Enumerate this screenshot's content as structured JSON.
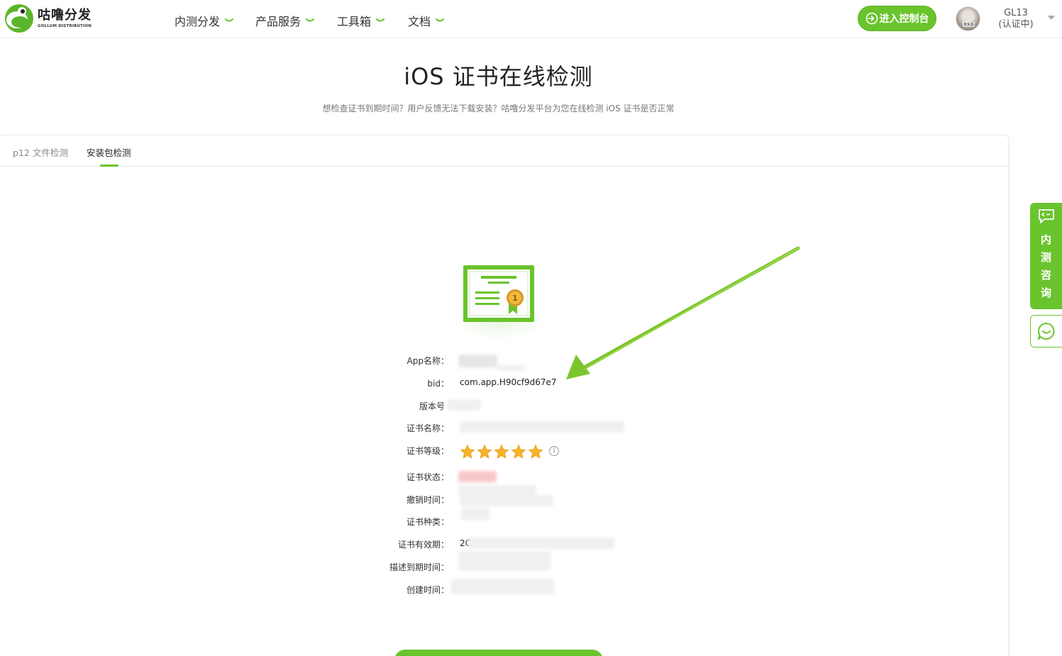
{
  "brand": {
    "name_cn": "咕噜分发",
    "name_en": "GOLLUM DISTRIBUTION",
    "accent": "#6ac42d"
  },
  "nav": {
    "items": [
      {
        "label": "内测分发"
      },
      {
        "label": "产品服务"
      },
      {
        "label": "工具箱"
      },
      {
        "label": "文档"
      }
    ],
    "console_label": "进入控制台",
    "avatar_tag": "未实名",
    "user_name": "GL13",
    "user_status": "(认证中)"
  },
  "page": {
    "title": "iOS 证书在线检测",
    "subtitle": "想检查证书到期时间？用户反馈无法下载安装？咕噜分发平台为您在线检测 iOS 证书是否正常"
  },
  "tabs": [
    {
      "label": "p12 文件检测",
      "active": false
    },
    {
      "label": "安装包检测",
      "active": true
    }
  ],
  "result": {
    "rows": [
      {
        "label": "App名称：",
        "value": ""
      },
      {
        "label": "bid：",
        "value": "com.app.H90cf9d67e7"
      },
      {
        "label": "版本号",
        "value": ""
      },
      {
        "label": "证书名称：",
        "value": ""
      },
      {
        "label": "证书等级：",
        "value": ""
      },
      {
        "label": "证书状态：",
        "value": ""
      },
      {
        "label": "撤销时间：",
        "value": ""
      },
      {
        "label": "证书种类：",
        "value": ""
      },
      {
        "label": "证书有效期：",
        "value": "2C"
      },
      {
        "label": "描述到期时间：",
        "value": ""
      },
      {
        "label": "创建时间：",
        "value": ""
      }
    ],
    "rating_stars": 5,
    "info_symbol": "i"
  },
  "float": {
    "consult_chars": [
      "内",
      "测",
      "咨",
      "询"
    ]
  }
}
